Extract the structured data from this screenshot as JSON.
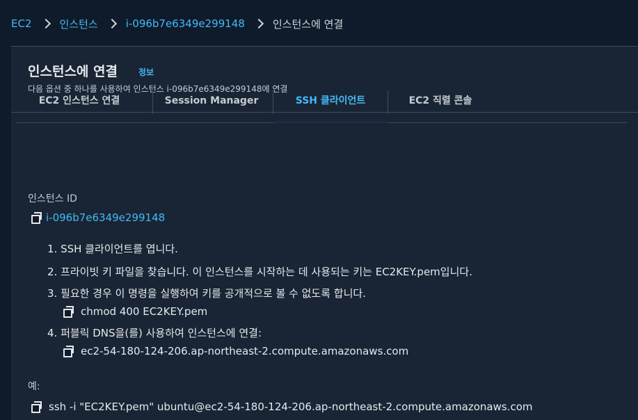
{
  "breadcrumb": {
    "items": [
      {
        "label": "EC2"
      },
      {
        "label": "인스턴스"
      },
      {
        "label": "i-096b7e6349e299148"
      },
      {
        "label": "인스턴스에 연결"
      }
    ]
  },
  "header": {
    "title": "인스턴스에 연결",
    "info_link": "정보",
    "description": "다음 옵션 중 하나를 사용하여 인스턴스 i-096b7e6349e299148에 연결"
  },
  "tabs": [
    {
      "label": "EC2 인스턴스 연결"
    },
    {
      "label": "Session Manager"
    },
    {
      "label": "SSH 클라이언트"
    },
    {
      "label": "EC2 직렬 콘솔"
    }
  ],
  "active_tab": "SSH 클라이언트",
  "instance": {
    "id_label": "인스턴스 ID",
    "id_value": "i-096b7e6349e299148"
  },
  "steps": [
    {
      "text": "1. SSH 클라이언트를 엽니다."
    },
    {
      "text": "2. 프라이빗 키 파일을 찾습니다. 이 인스턴스를 시작하는 데 사용되는 키는 EC2KEY.pem입니다."
    },
    {
      "text": "3. 필요한 경우 이 명령을 실행하여 키를 공개적으로 볼 수 없도록 합니다.",
      "code": "chmod 400 EC2KEY.pem"
    },
    {
      "text": "4. 퍼블릭 DNS을(를) 사용하여 인스턴스에 연결:",
      "code": "ec2-54-180-124-206.ap-northeast-2.compute.amazonaws.com"
    }
  ],
  "example": {
    "label": "예:",
    "command": "ssh -i \"EC2KEY.pem\" ubuntu@ec2-54-180-124-206.ap-northeast-2.compute.amazonaws.com"
  },
  "colors": {
    "background": "#0f1b2a",
    "panel": "#192534",
    "link": "#44b9f7",
    "text": "#e6e9ee",
    "divider": "#414d5c"
  },
  "icons": [
    "chevron-right-icon",
    "copy-icon"
  ]
}
